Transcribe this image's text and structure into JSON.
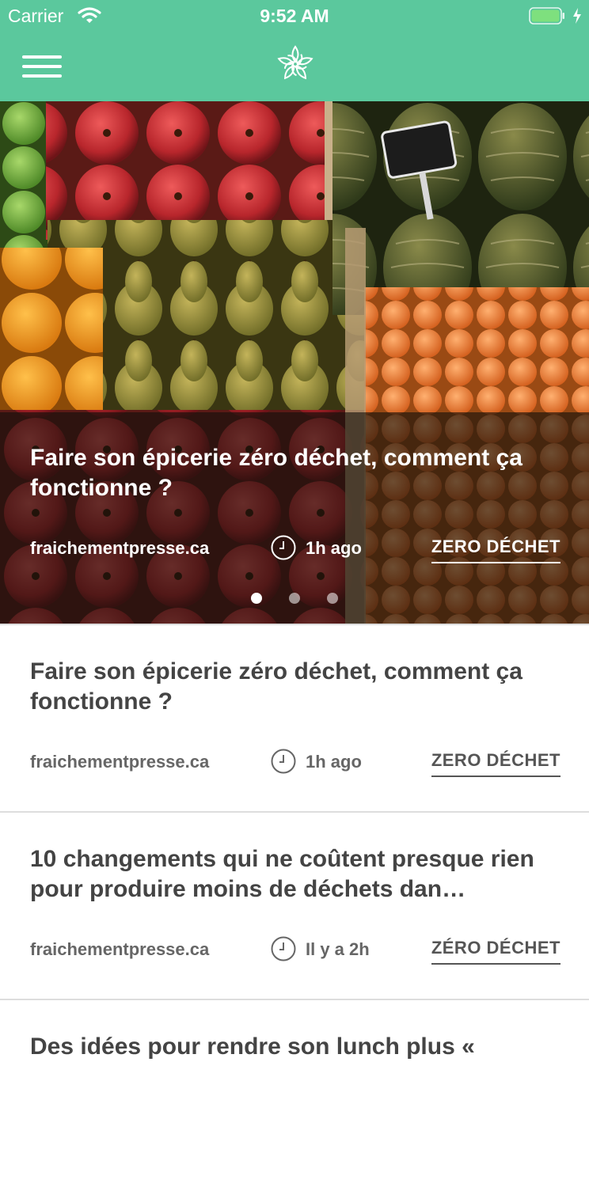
{
  "status_bar": {
    "carrier": "Carrier",
    "time": "9:52 AM"
  },
  "nav": {
    "menu_icon": "hamburger-menu-icon",
    "logo_icon": "flower-logo-icon",
    "color": "#5bc89d"
  },
  "hero": {
    "title": "Faire son épicerie zéro déchet, comment ça fonctionne ?",
    "source": "fraichementpresse.ca",
    "time": "1h ago",
    "tag": "ZERO DÉCHET",
    "page_count": 3,
    "active_page": 1
  },
  "articles": [
    {
      "title": "Faire son épicerie zéro déchet, comment ça fonctionne ?",
      "source": "fraichementpresse.ca",
      "time": "1h ago",
      "tag": "ZERO DÉCHET"
    },
    {
      "title": "10 changements qui ne coûtent presque rien pour produire moins de déchets dan…",
      "source": "fraichementpresse.ca",
      "time": "Il y a 2h",
      "tag": "ZÉRO DÉCHET"
    },
    {
      "title": "Des idées pour rendre son lunch plus «",
      "source": "",
      "time": "",
      "tag": ""
    }
  ]
}
